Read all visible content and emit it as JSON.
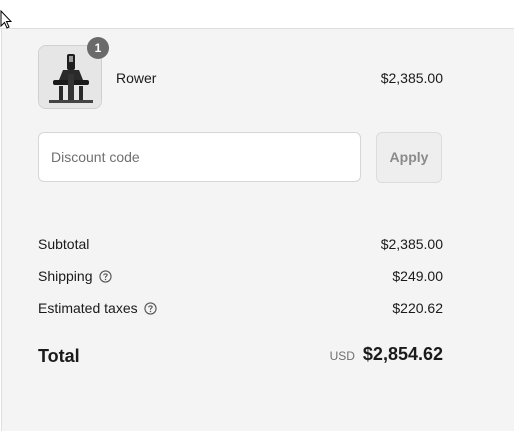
{
  "line_item": {
    "quantity": "1",
    "name": "Rower",
    "price": "$2,385.00",
    "thumbnail_icon": "rower-machine-image"
  },
  "discount": {
    "placeholder": "Discount code",
    "value": "",
    "apply_label": "Apply"
  },
  "summary": {
    "subtotal_label": "Subtotal",
    "subtotal_value": "$2,385.00",
    "shipping_label": "Shipping",
    "shipping_value": "$249.00",
    "taxes_label": "Estimated taxes",
    "taxes_value": "$220.62",
    "help_icon": "question-circle-icon"
  },
  "total": {
    "label": "Total",
    "currency": "USD",
    "amount": "$2,854.62"
  },
  "colors": {
    "panel_bg": "#f4f4f4",
    "badge_bg": "#6a6a6a",
    "text": "#1a1a1a",
    "muted": "#707070"
  }
}
